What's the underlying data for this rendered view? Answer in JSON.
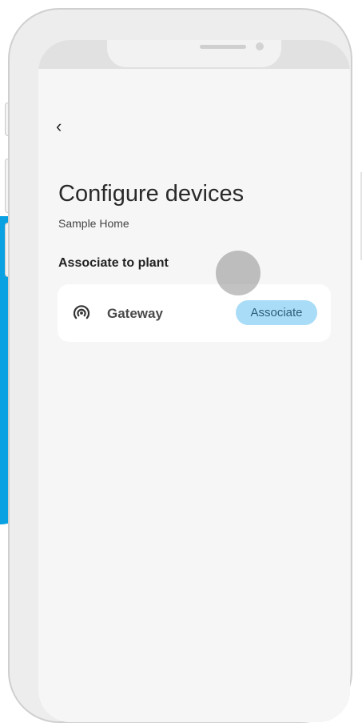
{
  "header": {
    "back_icon": "chevron-left-icon",
    "back_glyph": "‹"
  },
  "page": {
    "title": "Configure devices",
    "subtitle": "Sample Home"
  },
  "section": {
    "heading": "Associate to plant"
  },
  "devices": [
    {
      "name": "Gateway",
      "icon": "gateway-signal-icon",
      "action_label": "Associate"
    }
  ],
  "colors": {
    "backdrop_accent": "#0aa1e2",
    "associate_button": "#a9dcf6",
    "screen_background": "#f6f6f6"
  }
}
